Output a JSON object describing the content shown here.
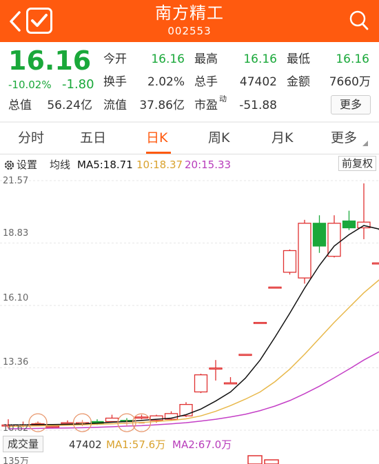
{
  "header": {
    "title": "南方精工",
    "code": "002553"
  },
  "quote": {
    "price": "16.16",
    "pct": "-10.02%",
    "change": "-1.80",
    "rows": [
      [
        {
          "l": "今开",
          "v": "16.16",
          "g": true
        },
        {
          "l": "最高",
          "v": "16.16",
          "g": true
        },
        {
          "l": "最低",
          "v": "16.16",
          "g": true
        }
      ],
      [
        {
          "l": "换手",
          "v": "2.02%",
          "g": false
        },
        {
          "l": "总手",
          "v": "47402",
          "g": false
        },
        {
          "l": "金额",
          "v": "7660万",
          "g": false
        }
      ],
      [
        {
          "l": "总值",
          "v": "56.24亿",
          "g": false
        },
        {
          "l": "流值",
          "v": "37.86亿",
          "g": false
        },
        {
          "l": "市盈",
          "v": "-51.88",
          "g": false
        }
      ]
    ],
    "pe_sup": "动",
    "more": "更多"
  },
  "tabs": [
    "分时",
    "五日",
    "日K",
    "周K",
    "月K",
    "更多"
  ],
  "active_tab": "日K",
  "ma": {
    "settings": "设置",
    "label": "均线",
    "ma5": "MA5:18.71",
    "ma10": "10:18.37",
    "ma20": "20:15.33",
    "adj": "前复权",
    "colors": {
      "ma5": "#111111",
      "ma10": "#e8b84a",
      "ma20": "#c43fc6",
      "up": "#e03030",
      "down": "#1aa83a"
    }
  },
  "chart_data": {
    "type": "candlestick",
    "y_ticks": [
      "21.57",
      "18.83",
      "16.10",
      "13.36",
      "10.62"
    ],
    "ylim": [
      10.62,
      21.57
    ],
    "candles": [
      {
        "o": 10.85,
        "h": 11.1,
        "l": 10.7,
        "c": 10.85
      },
      {
        "o": 10.85,
        "h": 11.0,
        "l": 10.75,
        "c": 10.85
      },
      {
        "o": 10.9,
        "h": 11.0,
        "l": 10.8,
        "c": 10.9
      },
      {
        "o": 10.75,
        "h": 10.85,
        "l": 10.7,
        "c": 10.8
      },
      {
        "o": 10.9,
        "h": 11.05,
        "l": 10.85,
        "c": 10.95
      },
      {
        "o": 10.95,
        "h": 11.0,
        "l": 10.9,
        "c": 10.95
      },
      {
        "o": 11.0,
        "h": 11.1,
        "l": 10.85,
        "c": 10.9
      },
      {
        "o": 11.0,
        "h": 11.3,
        "l": 10.95,
        "c": 11.15
      },
      {
        "o": 11.05,
        "h": 11.15,
        "l": 11.0,
        "c": 11.0
      },
      {
        "o": 11.2,
        "h": 11.3,
        "l": 11.1,
        "c": 11.2
      },
      {
        "o": 11.05,
        "h": 11.3,
        "l": 10.95,
        "c": 11.25
      },
      {
        "o": 11.1,
        "h": 11.45,
        "l": 11.05,
        "c": 11.35
      },
      {
        "o": 11.25,
        "h": 11.85,
        "l": 11.2,
        "c": 11.75
      },
      {
        "o": 12.3,
        "h": 13.1,
        "l": 12.25,
        "c": 13.05
      },
      {
        "o": 13.35,
        "h": 13.7,
        "l": 12.8,
        "c": 13.35
      },
      {
        "o": 12.7,
        "h": 12.95,
        "l": 12.65,
        "c": 12.7
      },
      {
        "o": 13.95,
        "h": 13.95,
        "l": 13.95,
        "c": 13.95
      },
      {
        "o": 15.35,
        "h": 15.35,
        "l": 15.35,
        "c": 15.35
      },
      {
        "o": 16.9,
        "h": 16.9,
        "l": 16.9,
        "c": 16.9
      },
      {
        "o": 17.55,
        "h": 18.55,
        "l": 17.45,
        "c": 18.5
      },
      {
        "o": 17.3,
        "h": 19.85,
        "l": 17.05,
        "c": 19.7
      },
      {
        "o": 19.7,
        "h": 20.05,
        "l": 18.4,
        "c": 18.7
      },
      {
        "o": 18.25,
        "h": 20.05,
        "l": 18.2,
        "c": 19.7
      },
      {
        "o": 19.8,
        "h": 20.25,
        "l": 19.4,
        "c": 19.5
      },
      {
        "o": 19.5,
        "h": 21.45,
        "l": 19.0,
        "c": 19.75
      },
      {
        "o": 17.96,
        "h": 17.96,
        "l": 17.96,
        "c": 17.96
      },
      {
        "o": 16.16,
        "h": 16.16,
        "l": 16.16,
        "c": 16.16
      }
    ],
    "ma5": [
      10.85,
      10.86,
      10.87,
      10.87,
      10.88,
      10.9,
      10.93,
      10.97,
      11.0,
      11.05,
      11.1,
      11.15,
      11.3,
      11.55,
      11.9,
      12.3,
      12.9,
      13.7,
      14.7,
      15.75,
      16.85,
      17.85,
      18.7,
      19.2,
      19.6,
      19.45,
      18.71
    ],
    "ma10": [
      10.78,
      10.8,
      10.81,
      10.83,
      10.84,
      10.86,
      10.88,
      10.9,
      10.93,
      10.96,
      11.0,
      11.05,
      11.12,
      11.25,
      11.45,
      11.7,
      11.98,
      12.3,
      12.75,
      13.3,
      13.95,
      14.65,
      15.35,
      16.0,
      16.65,
      17.2,
      17.6
    ],
    "ma20": [
      10.68,
      10.69,
      10.7,
      10.71,
      10.72,
      10.73,
      10.75,
      10.77,
      10.8,
      10.82,
      10.86,
      10.9,
      10.95,
      11.02,
      11.1,
      11.2,
      11.32,
      11.48,
      11.68,
      11.92,
      12.22,
      12.55,
      12.92,
      13.3,
      13.7,
      14.05,
      14.35
    ]
  },
  "volume": {
    "btn": "成交量",
    "val": "47402",
    "ma1": "MA1:57.6万",
    "ma2": "MA2:67.0万",
    "tick": "135万"
  }
}
